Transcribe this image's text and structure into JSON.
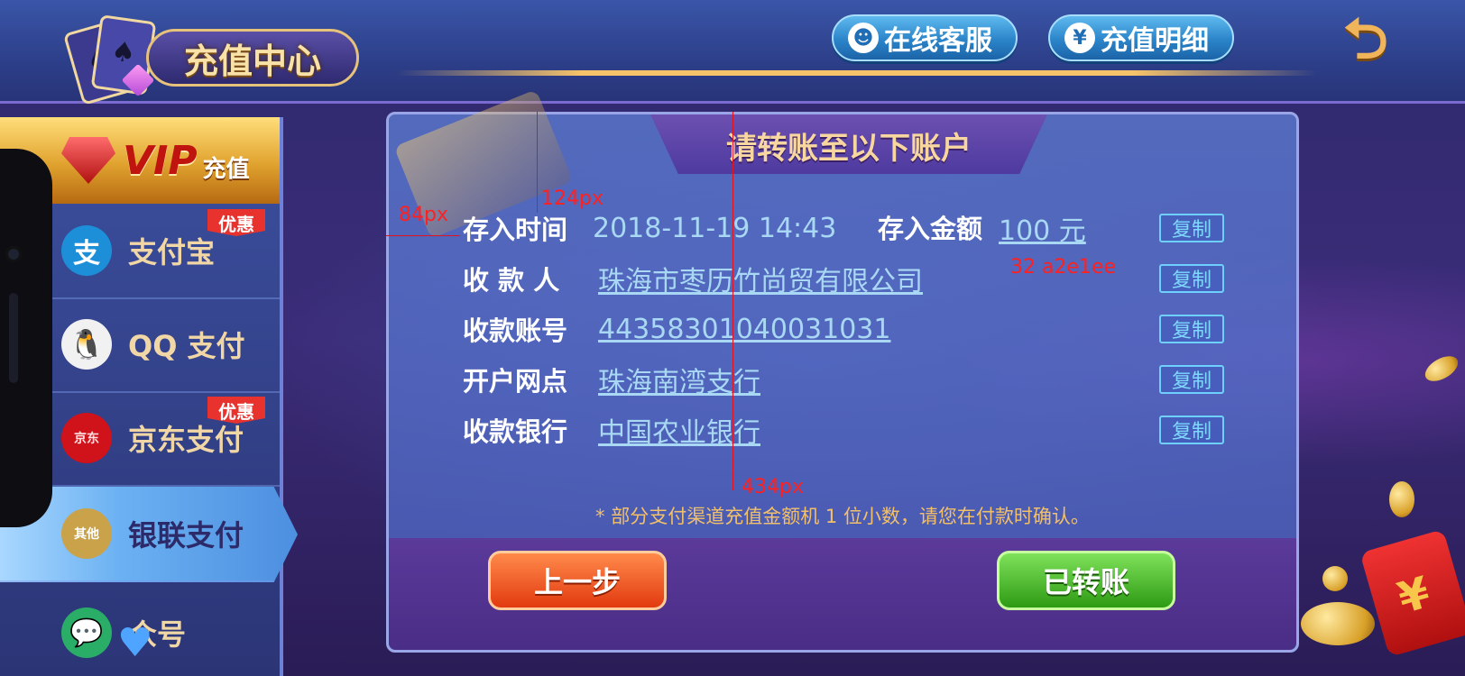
{
  "header": {
    "title": "充值中心",
    "buttons": {
      "service": "在线客服",
      "detail": "充值明细"
    }
  },
  "sidebar": {
    "vip": {
      "brand": "VIP",
      "label": "充值"
    },
    "items": [
      {
        "label": "支付宝",
        "icon": "alipay-icon",
        "icon_glyph": "支",
        "badge": "优惠"
      },
      {
        "label": "QQ 支付",
        "icon": "qq-penguin-icon",
        "icon_glyph": "🐧",
        "badge": ""
      },
      {
        "label": "京东支付",
        "icon": "jd-pay-icon",
        "icon_glyph": "京东",
        "badge": "优惠"
      },
      {
        "label": "银联支付",
        "icon": "unionpay-icon",
        "icon_glyph": "其他",
        "badge": "",
        "active": true
      },
      {
        "label": "众号",
        "icon": "wechat-icon",
        "icon_glyph": "💬",
        "badge": ""
      }
    ]
  },
  "panel": {
    "title": "请转账至以下账户",
    "fields": {
      "time_label": "存入时间",
      "time_value": "2018-11-19 14:43",
      "amount_label": "存入金额",
      "amount_value": "100 元",
      "payee_label": "收 款 人",
      "payee_value": "珠海市枣历竹尚贸有限公司",
      "account_label": "收款账号",
      "account_value": "44358301040031031",
      "branch_label": "开户网点",
      "branch_value": "珠海南湾支行",
      "bank_label": "收款银行",
      "bank_value": "中国农业银行"
    },
    "copy_label": "复制",
    "note": "* 部分支付渠道充值金额机 1 位小数，请您在付款时确认。",
    "prev_label": "上一步",
    "done_label": "已转账"
  },
  "annotations": {
    "a1": "124px",
    "a2": "84px",
    "a3": "32 a2e1ee",
    "a4": "434px",
    "color": "#e0141e"
  },
  "decor": {
    "redbag_symbol": "¥",
    "back_symbol": "⮌"
  }
}
